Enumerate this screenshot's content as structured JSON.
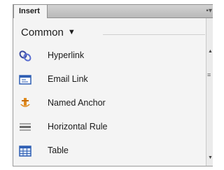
{
  "panel": {
    "tab_label": "Insert",
    "menu_icon": "panel-menu-icon"
  },
  "category": {
    "selected": "Common",
    "caret": "▼"
  },
  "items": [
    {
      "label": "Hyperlink",
      "icon": "hyperlink-icon"
    },
    {
      "label": "Email Link",
      "icon": "email-link-icon"
    },
    {
      "label": "Named Anchor",
      "icon": "named-anchor-icon"
    },
    {
      "label": "Horizontal Rule",
      "icon": "horizontal-rule-icon"
    },
    {
      "label": "Table",
      "icon": "table-icon"
    }
  ],
  "colors": {
    "titlebar": "#c4c4c4",
    "panel_bg": "#f4f4f4",
    "icon_blue": "#2f5fb3",
    "icon_orange": "#e08a1e"
  }
}
